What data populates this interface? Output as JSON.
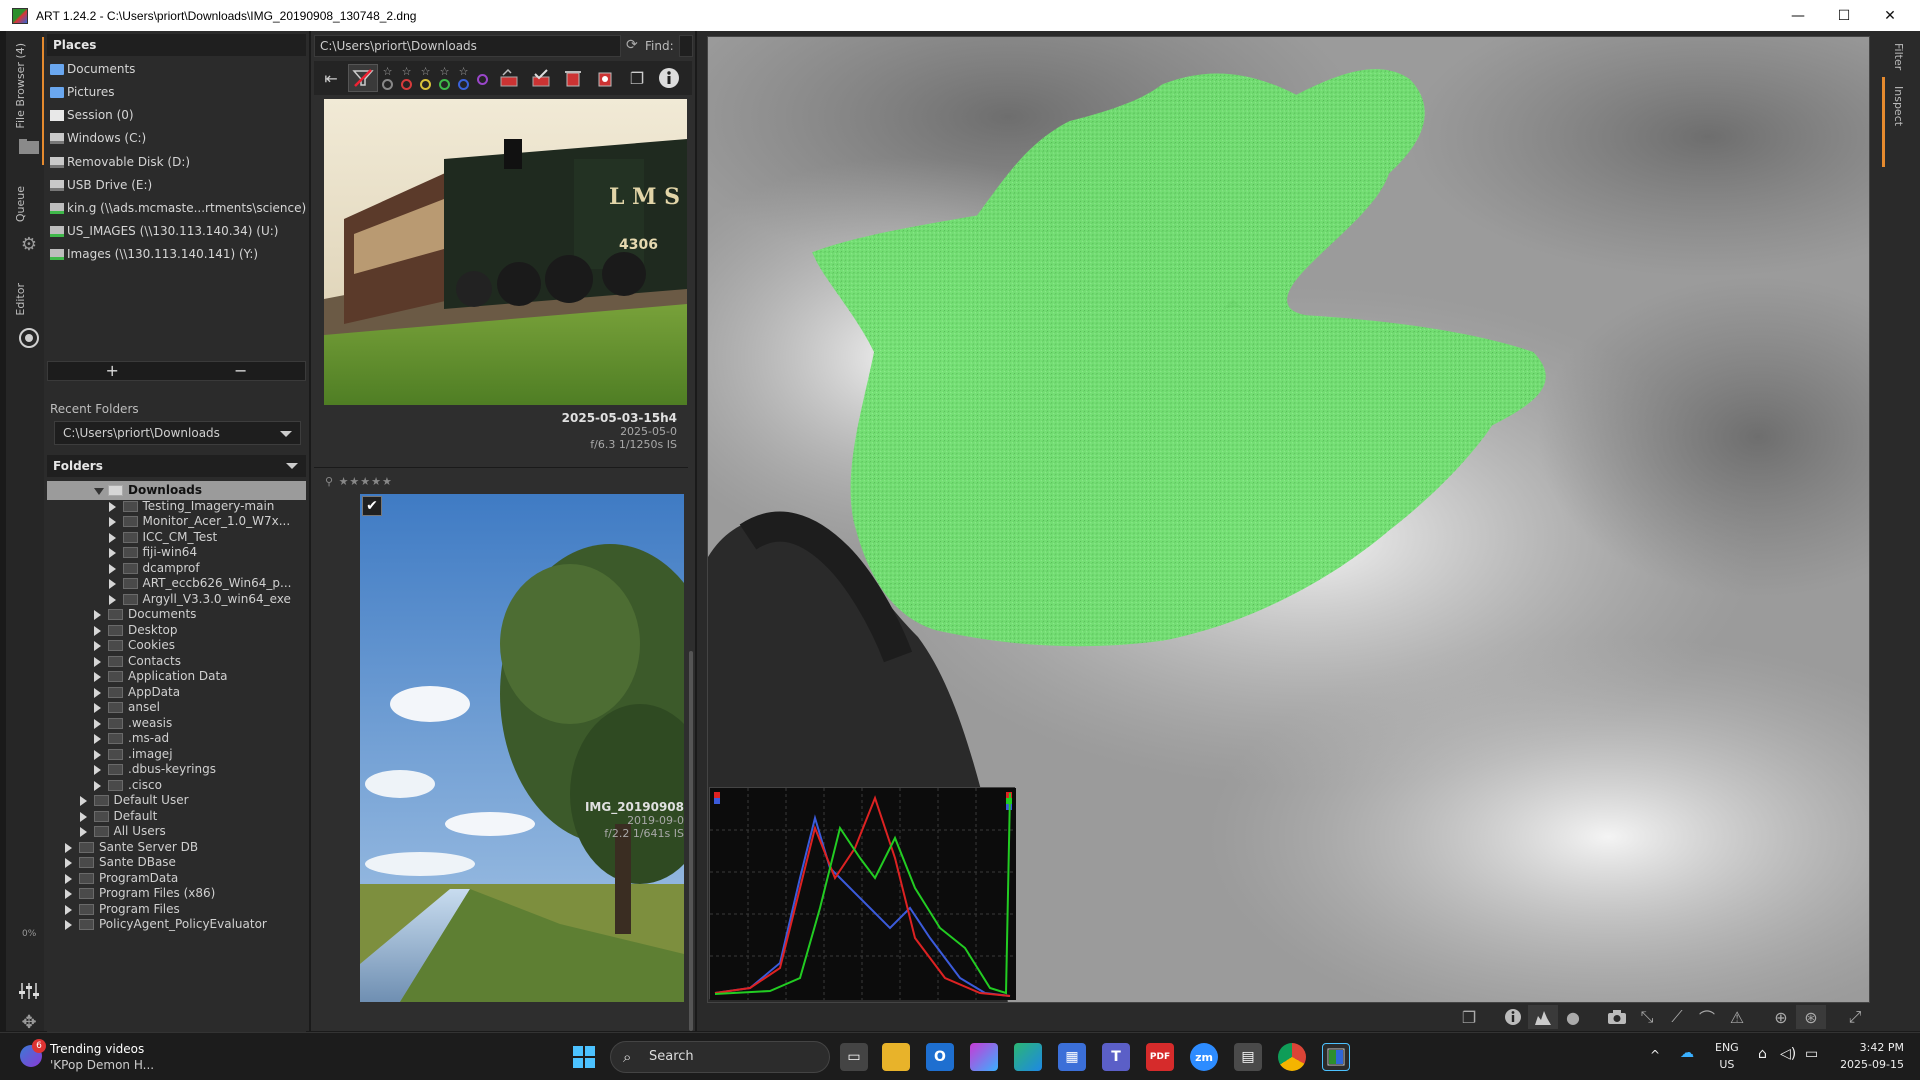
{
  "window": {
    "title": "ART 1.24.2 - C:\\Users\\priort\\Downloads\\IMG_20190908_130748_2.dng",
    "minimize": "—",
    "maximize": "☐",
    "close": "✕"
  },
  "left_tabs": {
    "file_browser": "File Browser (4)",
    "queue": "Queue",
    "editor": "Editor",
    "progress": "0%"
  },
  "places": {
    "header": "Places",
    "items": [
      {
        "label": "Documents",
        "icon": "folder-icon"
      },
      {
        "label": "Pictures",
        "icon": "folder-icon"
      },
      {
        "label": "Session (0)",
        "icon": "session-icon"
      },
      {
        "label": "Windows (C:)",
        "icon": "drive-icon"
      },
      {
        "label": "Removable Disk (D:)",
        "icon": "drive-icon"
      },
      {
        "label": "USB Drive (E:)",
        "icon": "drive-icon"
      },
      {
        "label": "kin.g (\\\\ads.mcmaste...rtments\\science) (Q:)",
        "icon": "network-drive-icon"
      },
      {
        "label": "US_IMAGES (\\\\130.113.140.34) (U:)",
        "icon": "network-drive-icon"
      },
      {
        "label": "Images (\\\\130.113.140.141) (Y:)",
        "icon": "network-drive-icon"
      }
    ],
    "add": "+",
    "remove": "−"
  },
  "recent": {
    "label": "Recent Folders",
    "value": "C:\\Users\\priort\\Downloads"
  },
  "folders": {
    "header": "Folders",
    "tree": [
      {
        "label": "Downloads",
        "level": 2,
        "selected": true,
        "expanded": true
      },
      {
        "label": "Testing_Imagery-main",
        "level": 3
      },
      {
        "label": "Monitor_Acer_1.0_W7x...",
        "level": 3
      },
      {
        "label": "ICC_CM_Test",
        "level": 3
      },
      {
        "label": "fiji-win64",
        "level": 3
      },
      {
        "label": "dcamprof",
        "level": 3
      },
      {
        "label": "ART_eccb626_Win64_p...",
        "level": 3
      },
      {
        "label": "Argyll_V3.3.0_win64_exe",
        "level": 3
      },
      {
        "label": "Documents",
        "level": 2
      },
      {
        "label": "Desktop",
        "level": 2
      },
      {
        "label": "Cookies",
        "level": 2
      },
      {
        "label": "Contacts",
        "level": 2
      },
      {
        "label": "Application Data",
        "level": 2
      },
      {
        "label": "AppData",
        "level": 2
      },
      {
        "label": "ansel",
        "level": 2
      },
      {
        "label": ".weasis",
        "level": 2
      },
      {
        "label": ".ms-ad",
        "level": 2
      },
      {
        "label": ".imagej",
        "level": 2
      },
      {
        "label": ".dbus-keyrings",
        "level": 2
      },
      {
        "label": ".cisco",
        "level": 2
      },
      {
        "label": "Default User",
        "level": 1
      },
      {
        "label": "Default",
        "level": 1
      },
      {
        "label": "All Users",
        "level": 1
      },
      {
        "label": "Sante Server DB",
        "level": 0
      },
      {
        "label": "Sante DBase",
        "level": 0
      },
      {
        "label": "ProgramData",
        "level": 0
      },
      {
        "label": "Program Files (x86)",
        "level": 0
      },
      {
        "label": "Program Files",
        "level": 0
      },
      {
        "label": "PolicyAgent_PolicyEvaluator",
        "level": 0
      }
    ]
  },
  "browser": {
    "path": "C:\\Users\\priort\\Downloads",
    "find_label": "Find:",
    "stars": [
      "☆",
      "☆",
      "☆",
      "☆",
      "☆"
    ],
    "label_colors": [
      "#888888",
      "#d63b3b",
      "#d8c23a",
      "#3fb84a",
      "#3a62d8",
      "#9a46c9"
    ],
    "thumbnails": [
      {
        "name": "2025-05-03-15h4",
        "date": "2025-05-0",
        "exif": "f/6.3 1/1250s IS"
      },
      {
        "name": "IMG_20190908",
        "date": "2019-09-0",
        "exif": "f/2.2 1/641s IS"
      }
    ],
    "small_stars": "★★★★★",
    "check": "✔"
  },
  "right_tabs": {
    "filter": "Filter",
    "inspect": "Inspect"
  },
  "taskbar": {
    "trending_title": "Trending videos",
    "trending_sub": "'KPop Demon H...",
    "badge": "6",
    "search_placeholder": "Search",
    "lang_top": "ENG",
    "lang_bottom": "US",
    "time": "3:42 PM",
    "date": "2025-09-15"
  }
}
